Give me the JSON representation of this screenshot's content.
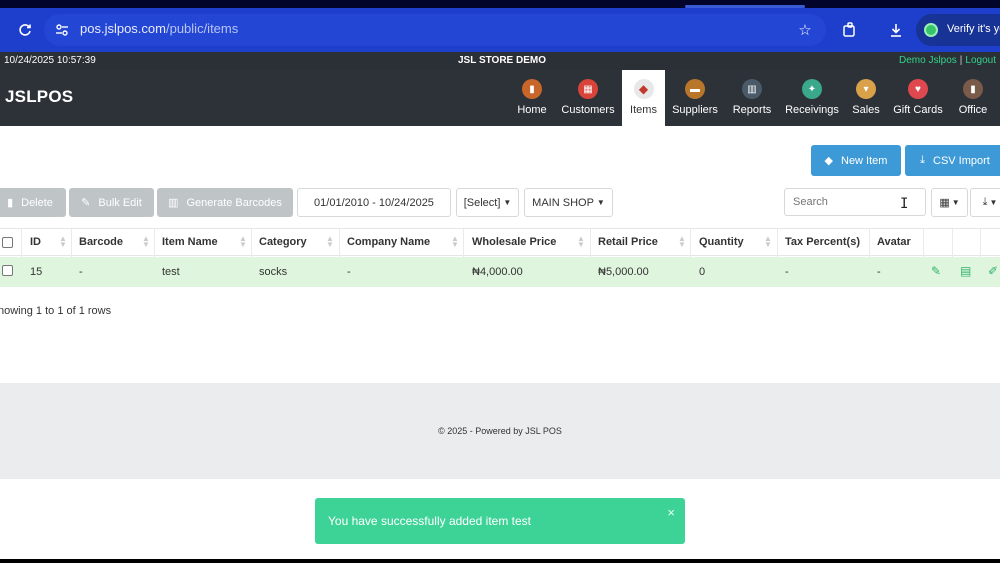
{
  "browser": {
    "url_host": "pos.jslpos.com",
    "url_path": "/public/items",
    "verify_label": "Verify it's yo"
  },
  "status": {
    "datetime": "10/24/2025 10:57:39",
    "store": "JSL STORE DEMO",
    "user": "Demo Jslpos",
    "separator": "|",
    "logout": "Logout"
  },
  "nav": {
    "brand": "JSLPOS",
    "items": [
      {
        "label": "Home",
        "color": "#c8662a"
      },
      {
        "label": "Customers",
        "color": "#d9443a"
      },
      {
        "label": "Items",
        "color": "#c0392b"
      },
      {
        "label": "Suppliers",
        "color": "#b8762a"
      },
      {
        "label": "Reports",
        "color": "#4a5a68"
      },
      {
        "label": "Receivings",
        "color": "#3aa88a"
      },
      {
        "label": "Sales",
        "color": "#d9a24a"
      },
      {
        "label": "Gift Cards",
        "color": "#e0484f"
      },
      {
        "label": "Office",
        "color": "#7a5a48"
      }
    ]
  },
  "toolbar": {
    "new_item": "New Item",
    "csv_import": "CSV Import",
    "delete": "Delete",
    "bulk_edit": "Bulk Edit",
    "generate_barcodes": "Generate Barcodes",
    "date_range": "01/01/2010 - 10/24/2025",
    "select_filter": "[Select]",
    "location": "MAIN SHOP",
    "search_placeholder": "Search"
  },
  "table": {
    "columns": [
      "ID",
      "Barcode",
      "Item Name",
      "Category",
      "Company Name",
      "Wholesale Price",
      "Retail Price",
      "Quantity",
      "Tax Percent(s)",
      "Avatar"
    ],
    "rows": [
      {
        "id": "15",
        "barcode": "-",
        "item_name": "test",
        "category": "socks",
        "company_name": "-",
        "wholesale_price": "₦4,000.00",
        "retail_price": "₦5,000.00",
        "quantity": "0",
        "tax_percents": "-",
        "avatar": "-"
      }
    ],
    "showing": "nowing 1 to 1 of 1 rows"
  },
  "footer": {
    "text": "© 2025 - Powered by JSL POS"
  },
  "toast": {
    "message": "You have successfully added item test",
    "close": "×"
  },
  "colors": {
    "accent": "#3e9ad6",
    "navbar": "#2d3138",
    "success_row": "#dff5dd",
    "toast": "#3ed396"
  }
}
